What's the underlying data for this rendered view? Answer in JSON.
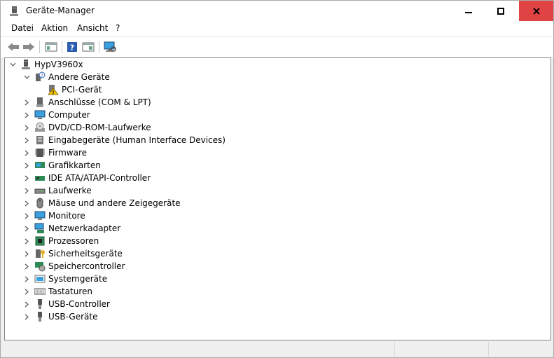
{
  "window": {
    "title": "Geräte-Manager"
  },
  "menu": {
    "items": [
      "Datei",
      "Aktion",
      "Ansicht",
      "?"
    ]
  },
  "tree": {
    "root": "HypV3960x",
    "other_devices": "Andere Geräte",
    "pci_device": "PCI-Gerät",
    "categories": [
      {
        "label": "Anschlüsse (COM & LPT)",
        "icon": "port-icon"
      },
      {
        "label": "Computer",
        "icon": "computer-icon"
      },
      {
        "label": "DVD/CD-ROM-Laufwerke",
        "icon": "dvd-drive-icon"
      },
      {
        "label": "Eingabegeräte (Human Interface Devices)",
        "icon": "hid-icon"
      },
      {
        "label": "Firmware",
        "icon": "firmware-icon"
      },
      {
        "label": "Grafikkarten",
        "icon": "graphics-card-icon"
      },
      {
        "label": "IDE ATA/ATAPI-Controller",
        "icon": "ide-controller-icon"
      },
      {
        "label": "Laufwerke",
        "icon": "disk-drive-icon"
      },
      {
        "label": "Mäuse und andere Zeigegeräte",
        "icon": "mouse-icon"
      },
      {
        "label": "Monitore",
        "icon": "monitor-icon"
      },
      {
        "label": "Netzwerkadapter",
        "icon": "network-adapter-icon"
      },
      {
        "label": "Prozessoren",
        "icon": "processor-icon"
      },
      {
        "label": "Sicherheitsgeräte",
        "icon": "security-device-icon"
      },
      {
        "label": "Speichercontroller",
        "icon": "storage-controller-icon"
      },
      {
        "label": "Systemgeräte",
        "icon": "system-devices-icon"
      },
      {
        "label": "Tastaturen",
        "icon": "keyboard-icon"
      },
      {
        "label": "USB-Controller",
        "icon": "usb-controller-icon"
      },
      {
        "label": "USB-Geräte",
        "icon": "usb-device-icon"
      }
    ]
  },
  "colors": {
    "close_button": "#e04343",
    "tree_border": "#828790"
  }
}
